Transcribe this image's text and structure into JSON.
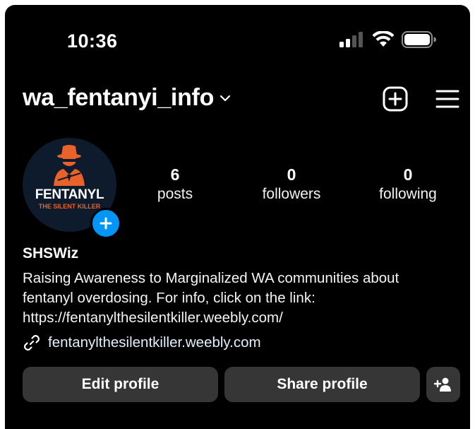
{
  "status_bar": {
    "time": "10:36",
    "icons": [
      "signal-icon",
      "wifi-icon",
      "battery-icon"
    ]
  },
  "header": {
    "username": "wa_fentanyi_info",
    "chevron": "chevron-down-icon",
    "actions": [
      "new-post-icon",
      "menu-icon"
    ]
  },
  "profile": {
    "avatar": {
      "line1": "FENTANYL",
      "line2": "THE SILENT KILLER"
    },
    "stats": [
      {
        "value": "6",
        "label": "posts"
      },
      {
        "value": "0",
        "label": "followers"
      },
      {
        "value": "0",
        "label": "following"
      }
    ],
    "display_name": "SHSWiz",
    "bio_lines": [
      "Raising Awareness to Marginalized WA communities about",
      "fentanyl overdosing. For info, click on the link:",
      "https://fentanylthesilentkiller.weebly.com/"
    ],
    "link": "fentanylthesilentkiller.weebly.com"
  },
  "buttons": {
    "edit": "Edit profile",
    "share": "Share profile",
    "discover_icon": "add-person-icon"
  },
  "colors": {
    "background": "#000000",
    "button": "#363636",
    "accent_blue": "#0095f6",
    "avatar_orange": "#e8622a"
  }
}
